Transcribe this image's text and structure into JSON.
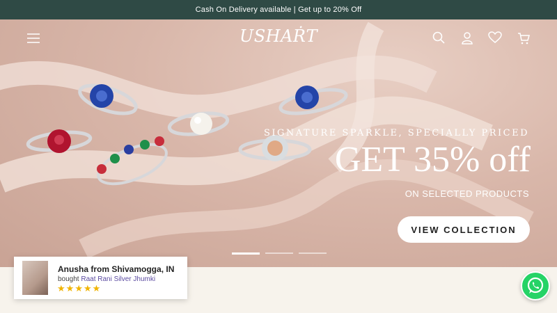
{
  "announcement": "Cash On Delivery available | Get up to 20% Off",
  "logo": "USHAṘT",
  "header_icons": [
    "menu-icon",
    "search-icon",
    "account-icon",
    "wishlist-heart-icon",
    "cart-icon"
  ],
  "hero": {
    "subtitle": "Signature Sparkle, Specially Priced",
    "title": "GET 35% off",
    "note": "ON SELECTED PRODUCTS",
    "cta": "VIEW COLLECTION",
    "slides_total": 3,
    "active_slide": 1
  },
  "notification": {
    "name": "Anusha from Shivamogga, IN",
    "bought_prefix": "bought ",
    "product": "Raat Rani Silver Jhumki",
    "rating": 5
  },
  "colors": {
    "announcement_bg": "#2f4a45",
    "rating_star": "#f0b400",
    "whatsapp": "#25d366"
  }
}
